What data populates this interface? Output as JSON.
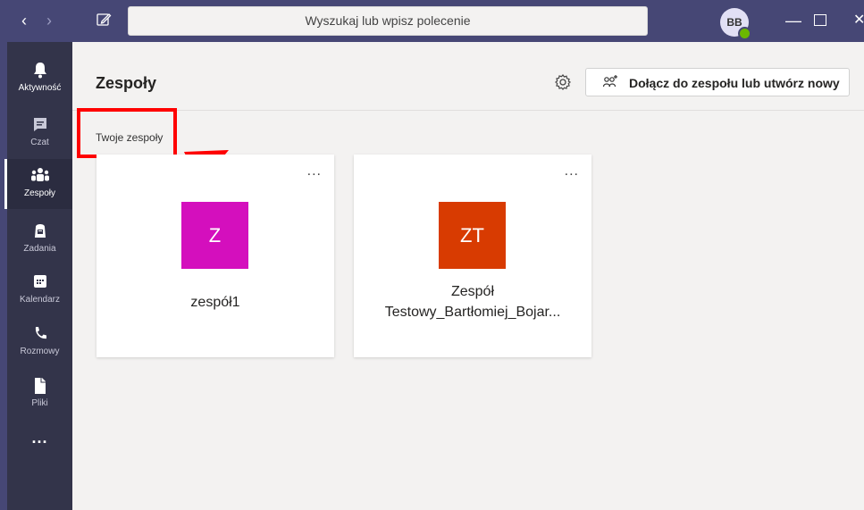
{
  "search": {
    "placeholder": "Wyszukaj lub wpisz polecenie"
  },
  "user": {
    "initials": "BB"
  },
  "header": {
    "title": "Zespoły",
    "join_button_label": "Dołącz do zespołu lub utwórz nowy"
  },
  "section": {
    "label": "Twoje zespoły"
  },
  "rail": {
    "items": [
      {
        "label": "Aktywność",
        "icon": "bell-icon"
      },
      {
        "label": "Czat",
        "icon": "chat-icon"
      },
      {
        "label": "Zespoły",
        "icon": "teams-icon"
      },
      {
        "label": "Zadania",
        "icon": "assignments-icon"
      },
      {
        "label": "Kalendarz",
        "icon": "calendar-icon"
      },
      {
        "label": "Rozmowy",
        "icon": "phone-icon"
      },
      {
        "label": "Pliki",
        "icon": "file-icon"
      }
    ],
    "more": "..."
  },
  "teams": [
    {
      "initials": "Z",
      "name": "zespół1",
      "color": "#d40fbd"
    },
    {
      "initials": "ZT",
      "name_line1": "Zespół",
      "name_line2": "Testowy_Bartłomiej_Bojar...",
      "color": "#d83b01"
    }
  ],
  "card_menu": "...",
  "colors": {
    "titlebar": "#464775",
    "rail": "#33344a",
    "highlight": "#ff0000"
  }
}
